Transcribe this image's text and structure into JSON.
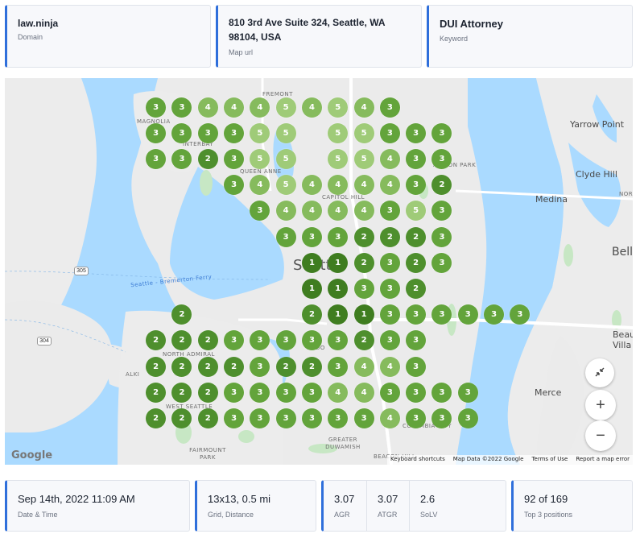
{
  "header": {
    "domain": {
      "value": "law.ninja",
      "label": "Domain"
    },
    "map_url": {
      "value": "810 3rd Ave Suite 324, Seattle, WA 98104, USA",
      "label": "Map url"
    },
    "keyword": {
      "value": "DUI Attorney",
      "label": "Keyword"
    }
  },
  "map": {
    "labels": {
      "fremont": "FREMONT",
      "magnolia": "MAGNOLIA",
      "interbay": "INTERBAY",
      "queen_anne": "QUEEN ANNE",
      "capitol_hill": "CAPITOL HILL",
      "madison_park": "ADISON PARK",
      "seattle": "Seattle",
      "ferry": "Seattle - Bremerton Ferry",
      "north_admiral": "NORTH ADMIRAL",
      "alki": "ALKI",
      "west_seattle": "WEST SEATTLE",
      "fairmount_park": "FAIRMOUNT PARK",
      "sodo": "SODO",
      "greater_duwamish": "GREATER DUWAMISH",
      "columbia_city": "COLUMBIA CITY",
      "beacon_hill": "BEACON HILL",
      "yarrow_point": "Yarrow Point",
      "clyde_hill": "Clyde Hill",
      "medina": "Medina",
      "bellevue": "Belle",
      "beaux_arts": "Beau Villa",
      "mercer": "Merce",
      "route_305": "305",
      "route_304": "304",
      "nor": "NOR"
    },
    "attribution": {
      "shortcuts": "Keyboard shortcuts",
      "data": "Map Data ©2022 Google",
      "terms": "Terms of Use",
      "report": "Report a map error"
    },
    "logo": "Google",
    "pin_colors": {
      "1": "#3f7d20",
      "2": "#4e8f2d",
      "3": "#63a43b",
      "4": "#86bb5d",
      "5": "#9fcb78"
    },
    "rank_rows": [
      {
        "row": 0,
        "start": 5.5,
        "values": [
          3,
          3,
          4,
          4,
          4,
          5,
          4,
          5,
          4,
          3
        ]
      },
      {
        "row": 1,
        "start": 5.5,
        "values": [
          3,
          3,
          3,
          3,
          5,
          5,
          null,
          5,
          5,
          3,
          3,
          3
        ]
      },
      {
        "row": 2,
        "start": 5.5,
        "values": [
          3,
          3,
          2,
          3,
          5,
          5,
          null,
          5,
          5,
          4,
          3,
          3
        ]
      },
      {
        "row": 3,
        "start": 8.5,
        "values": [
          3,
          4,
          5,
          4,
          4,
          4,
          4,
          3,
          2
        ]
      },
      {
        "row": 4,
        "start": 9.5,
        "values": [
          3,
          4,
          4,
          4,
          4,
          3,
          5,
          3
        ]
      },
      {
        "row": 5,
        "start": 10.5,
        "values": [
          3,
          3,
          3,
          2,
          2,
          2,
          3
        ]
      },
      {
        "row": 6,
        "start": 11.5,
        "values": [
          1,
          1,
          2,
          3,
          2,
          3
        ]
      },
      {
        "row": 7,
        "start": 11.5,
        "values": [
          1,
          1,
          3,
          3,
          2
        ]
      },
      {
        "row": 8,
        "start": 6.5,
        "values": [
          2,
          null,
          null,
          null,
          null,
          2,
          1,
          1,
          3,
          3,
          3,
          3,
          3,
          3
        ]
      },
      {
        "row": 9,
        "start": 5.5,
        "values": [
          2,
          2,
          2,
          3,
          3,
          3,
          3,
          3,
          2,
          3,
          3
        ]
      },
      {
        "row": 10,
        "start": 5.5,
        "values": [
          2,
          2,
          2,
          2,
          3,
          2,
          2,
          3,
          4,
          4,
          3
        ]
      },
      {
        "row": 11,
        "start": 5.5,
        "values": [
          2,
          2,
          2,
          3,
          3,
          3,
          3,
          4,
          4,
          3,
          3,
          3,
          3
        ]
      },
      {
        "row": 12,
        "start": 5.5,
        "values": [
          2,
          2,
          2,
          3,
          3,
          3,
          3,
          3,
          3,
          4,
          3,
          3,
          3
        ]
      }
    ]
  },
  "footer": {
    "date": {
      "value": "Sep 14th, 2022 11:09 AM",
      "label": "Date & Time"
    },
    "grid": {
      "value": "13x13, 0.5 mi",
      "label": "Grid, Distance"
    },
    "agr": {
      "value": "3.07",
      "label": "AGR"
    },
    "atgr": {
      "value": "3.07",
      "label": "ATGR"
    },
    "solv": {
      "value": "2.6",
      "label": "SoLV"
    },
    "top3": {
      "value": "92 of 169",
      "label": "Top 3 positions"
    }
  }
}
